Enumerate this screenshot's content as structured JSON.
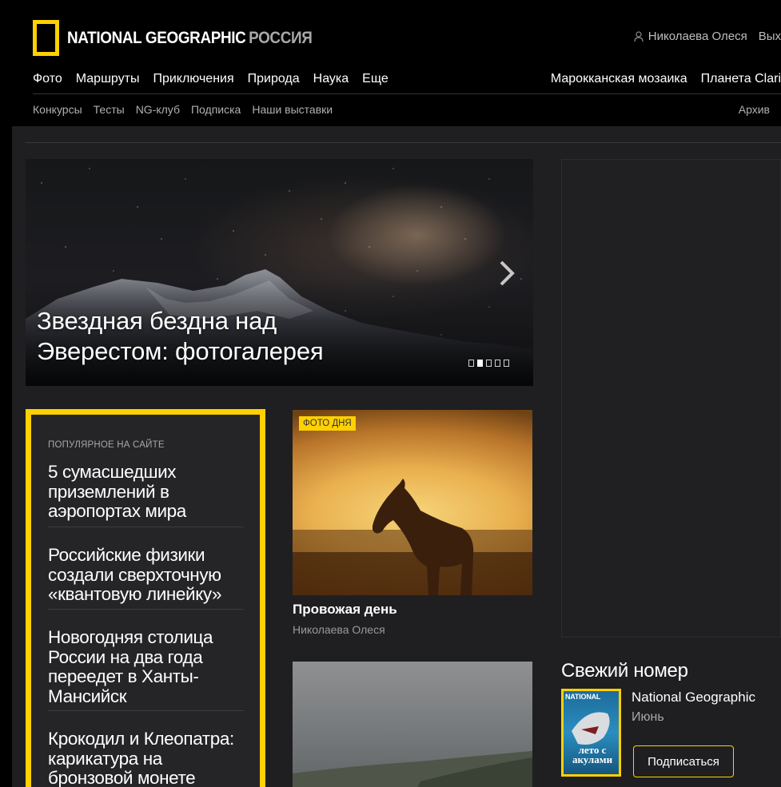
{
  "header": {
    "logo_text": "NATIONAL GEOGRAPHIC",
    "logo_suffix": "РОССИЯ",
    "user_name": "Николаева Олеся",
    "logout_label": "Вых",
    "main_nav": [
      "Фото",
      "Маршруты",
      "Приключения",
      "Природа",
      "Наука",
      "Еще"
    ],
    "right_nav": [
      "Марокканская мозаика",
      "Планета Clari"
    ],
    "sub_nav": [
      "Конкурсы",
      "Тесты",
      "NG-клуб",
      "Подписка",
      "Наши выставки"
    ],
    "archive_label": "Архив"
  },
  "hero": {
    "title": "Звездная бездна над Эверестом: фотогалерея",
    "slide_count": 5,
    "active_slide": 1
  },
  "popular": {
    "label": "ПОПУЛЯРНОЕ НА САЙТЕ",
    "items": [
      "5 сумасшедших приземлений в аэропортах мира",
      "Российские физики создали сверхточную «квантовую линейку»",
      "Новогодняя столица России на два года переедет в Ханты-Мансийск",
      "Крокодил и Клеопатра: карикатура на бронзовой монете"
    ]
  },
  "photo_of_day": {
    "badge": "ФОТО ДНЯ",
    "title": "Провожая день",
    "author": "Николаева Олеся"
  },
  "fresh_issue": {
    "title": "Свежий номер",
    "magazine": "National Geographic",
    "month": "Июнь",
    "subscribe_label": "Подписаться",
    "cover_top": "NATIONAL",
    "cover_text": "лето с акулами"
  },
  "colors": {
    "accent": "#ffd100",
    "header_bg": "#000000",
    "page_bg": "#1f1f21"
  }
}
